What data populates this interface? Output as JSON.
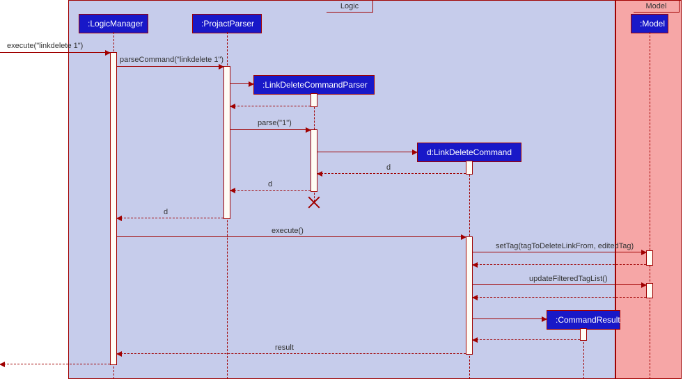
{
  "regions": {
    "logic": {
      "title": "Logic"
    },
    "model": {
      "title": "Model"
    }
  },
  "participants": {
    "logicManager": ":LogicManager",
    "projactParser": ":ProjactParser",
    "linkDeleteCommandParser": ":LinkDeleteCommandParser",
    "linkDeleteCommand": "d:LinkDeleteCommand",
    "commandResult": ":CommandResult",
    "model": ":Model"
  },
  "messages": {
    "execute_in": "execute(\"linkdelete 1\")",
    "parseCommand": "parseCommand(\"linkdelete 1\")",
    "parse": "parse(\"1\")",
    "return_d1": "d",
    "return_d2": "d",
    "return_d3": "d",
    "execute": "execute()",
    "setTag": "setTag(tagToDeleteLinkFrom, editedTag)",
    "updateFilteredTagList": "updateFilteredTagList()",
    "result": "result"
  },
  "chart_data": {
    "type": "sequence-diagram",
    "regions": [
      {
        "name": "Logic",
        "participants": [
          ":LogicManager",
          ":ProjactParser",
          ":LinkDeleteCommandParser",
          "d:LinkDeleteCommand",
          ":CommandResult"
        ]
      },
      {
        "name": "Model",
        "participants": [
          ":Model"
        ]
      }
    ],
    "participants": [
      ":LogicManager",
      ":ProjactParser",
      ":LinkDeleteCommandParser",
      "d:LinkDeleteCommand",
      ":CommandResult",
      ":Model"
    ],
    "interactions": [
      {
        "from": "external",
        "to": ":LogicManager",
        "type": "call",
        "label": "execute(\"linkdelete 1\")"
      },
      {
        "from": ":LogicManager",
        "to": ":ProjactParser",
        "type": "call",
        "label": "parseCommand(\"linkdelete 1\")"
      },
      {
        "from": ":ProjactParser",
        "to": ":LinkDeleteCommandParser",
        "type": "create",
        "label": ""
      },
      {
        "from": ":LinkDeleteCommandParser",
        "to": ":ProjactParser",
        "type": "return",
        "label": ""
      },
      {
        "from": ":ProjactParser",
        "to": ":LinkDeleteCommandParser",
        "type": "call",
        "label": "parse(\"1\")"
      },
      {
        "from": ":LinkDeleteCommandParser",
        "to": "d:LinkDeleteCommand",
        "type": "create",
        "label": ""
      },
      {
        "from": "d:LinkDeleteCommand",
        "to": ":LinkDeleteCommandParser",
        "type": "return",
        "label": "d"
      },
      {
        "from": ":LinkDeleteCommandParser",
        "to": ":ProjactParser",
        "type": "return",
        "label": "d"
      },
      {
        "from": ":LinkDeleteCommandParser",
        "to": null,
        "type": "destroy",
        "label": ""
      },
      {
        "from": ":ProjactParser",
        "to": ":LogicManager",
        "type": "return",
        "label": "d"
      },
      {
        "from": ":LogicManager",
        "to": "d:LinkDeleteCommand",
        "type": "call",
        "label": "execute()"
      },
      {
        "from": "d:LinkDeleteCommand",
        "to": ":Model",
        "type": "call",
        "label": "setTag(tagToDeleteLinkFrom, editedTag)"
      },
      {
        "from": ":Model",
        "to": "d:LinkDeleteCommand",
        "type": "return",
        "label": ""
      },
      {
        "from": "d:LinkDeleteCommand",
        "to": ":Model",
        "type": "call",
        "label": "updateFilteredTagList()"
      },
      {
        "from": ":Model",
        "to": "d:LinkDeleteCommand",
        "type": "return",
        "label": ""
      },
      {
        "from": "d:LinkDeleteCommand",
        "to": ":CommandResult",
        "type": "create",
        "label": ""
      },
      {
        "from": ":CommandResult",
        "to": "d:LinkDeleteCommand",
        "type": "return",
        "label": ""
      },
      {
        "from": "d:LinkDeleteCommand",
        "to": ":LogicManager",
        "type": "return",
        "label": "result"
      },
      {
        "from": ":LogicManager",
        "to": "external",
        "type": "return",
        "label": ""
      }
    ]
  }
}
